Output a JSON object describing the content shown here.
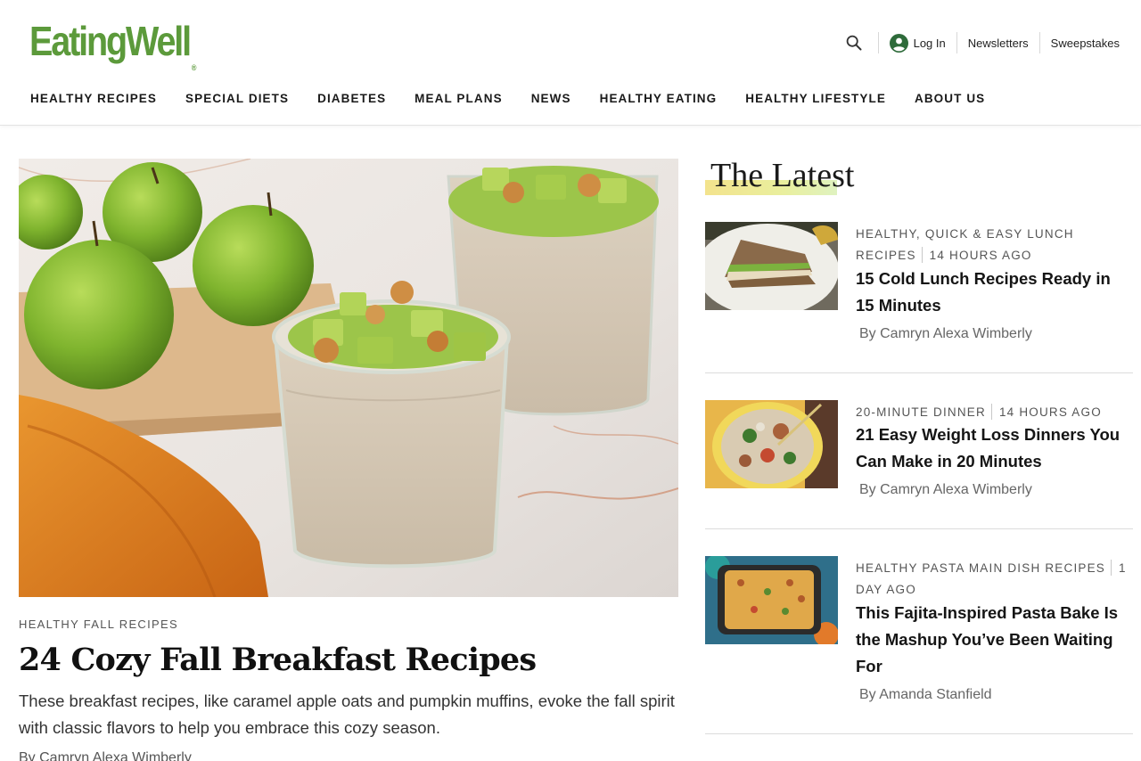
{
  "header": {
    "logo_text": "EatingWell",
    "logo_tm": "®",
    "brand_color": "#5c9a3b",
    "search_icon": "search-icon",
    "login_icon": "user-circle-icon",
    "login_label": "Log In",
    "newsletters_label": "Newsletters",
    "sweepstakes_label": "Sweepstakes"
  },
  "nav": {
    "items": [
      "HEALTHY RECIPES",
      "SPECIAL DIETS",
      "DIABETES",
      "MEAL PLANS",
      "NEWS",
      "HEALTHY EATING",
      "HEALTHY LIFESTYLE",
      "ABOUT US"
    ]
  },
  "hero": {
    "kicker": "HEALTHY FALL RECIPES",
    "title": "24 Cozy Fall Breakfast Recipes",
    "description": "These breakfast recipes, like caramel apple oats and pumpkin muffins, evoke the fall spirit with classic flavors to help you embrace this cozy season.",
    "byline": "By Camryn Alexa Wimberly"
  },
  "latest": {
    "heading": "The Latest",
    "articles": [
      {
        "category": "HEALTHY, QUICK & EASY LUNCH RECIPES",
        "time": "14 HOURS AGO",
        "title": "15 Cold Lunch Recipes Ready in 15 Minutes",
        "byline": "By Camryn Alexa Wimberly"
      },
      {
        "category": "20-MINUTE DINNER",
        "time": "14 HOURS AGO",
        "title": "21 Easy Weight Loss Dinners You Can Make in 20 Minutes",
        "byline": "By Camryn Alexa Wimberly"
      },
      {
        "category": "HEALTHY PASTA MAIN DISH RECIPES",
        "time": "1 DAY AGO",
        "title": "This Fajita-Inspired Pasta Bake Is the Mashup You’ve Been Waiting For",
        "byline": "By Amanda Stanfield"
      }
    ]
  }
}
